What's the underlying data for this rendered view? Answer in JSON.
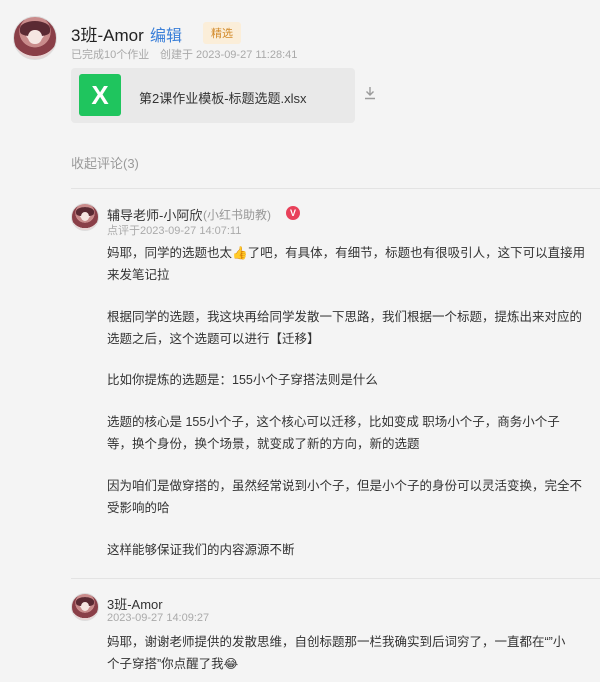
{
  "header": {
    "user_name": "3班-Amor",
    "edit_label": "编辑",
    "badge": "精选",
    "completed": "已完成10个作业",
    "created": "创建于 2023-09-27 11:28:41"
  },
  "file": {
    "icon_letter": "X",
    "name": "第2课作业模板-标题选题.xlsx",
    "icon_color": "#1fc55e",
    "download_icon": "download-icon"
  },
  "comments_toggle": "收起评论(3)",
  "comments": [
    {
      "author": "辅导老师-小阿欣",
      "role": "(小红书助教)",
      "verified": "V",
      "time": "点评于2023-09-27 14:07:11",
      "paragraphs": [
        {
          "lines": [
            "妈耶，同学的选题也太👍了吧，有具体，有细节，标题也有很吸引人，这下可以直接用",
            "来发笔记拉"
          ]
        },
        {
          "lines": [
            "根据同学的选题，我这块再给同学发散一下思路，我们根据一个标题，提炼出来对应的",
            "选题之后，这个选题可以进行【迁移】"
          ]
        },
        {
          "lines": [
            "比如你提炼的选题是：155小个子穿搭法则是什么"
          ]
        },
        {
          "lines": [
            "选题的核心是  155小个子，这个核心可以迁移，比如变成 职场小个子，商务小个子",
            "等，换个身份，换个场景，就变成了新的方向，新的选题"
          ]
        },
        {
          "lines": [
            "因为咱们是做穿搭的，虽然经常说到小个子，但是小个子的身份可以灵活变换，完全不",
            "受影响的哈"
          ]
        },
        {
          "lines": [
            "这样能够保证我们的内容源源不断"
          ]
        }
      ]
    },
    {
      "author": "3班-Amor",
      "time": "2023-09-27 14:09:27",
      "paragraphs": [
        {
          "lines": [
            "妈耶，谢谢老师提供的发散思维，自创标题那一栏我确实到后词穷了，一直都在“”小",
            "个子穿搭”你点醒了我😂"
          ]
        }
      ]
    }
  ]
}
